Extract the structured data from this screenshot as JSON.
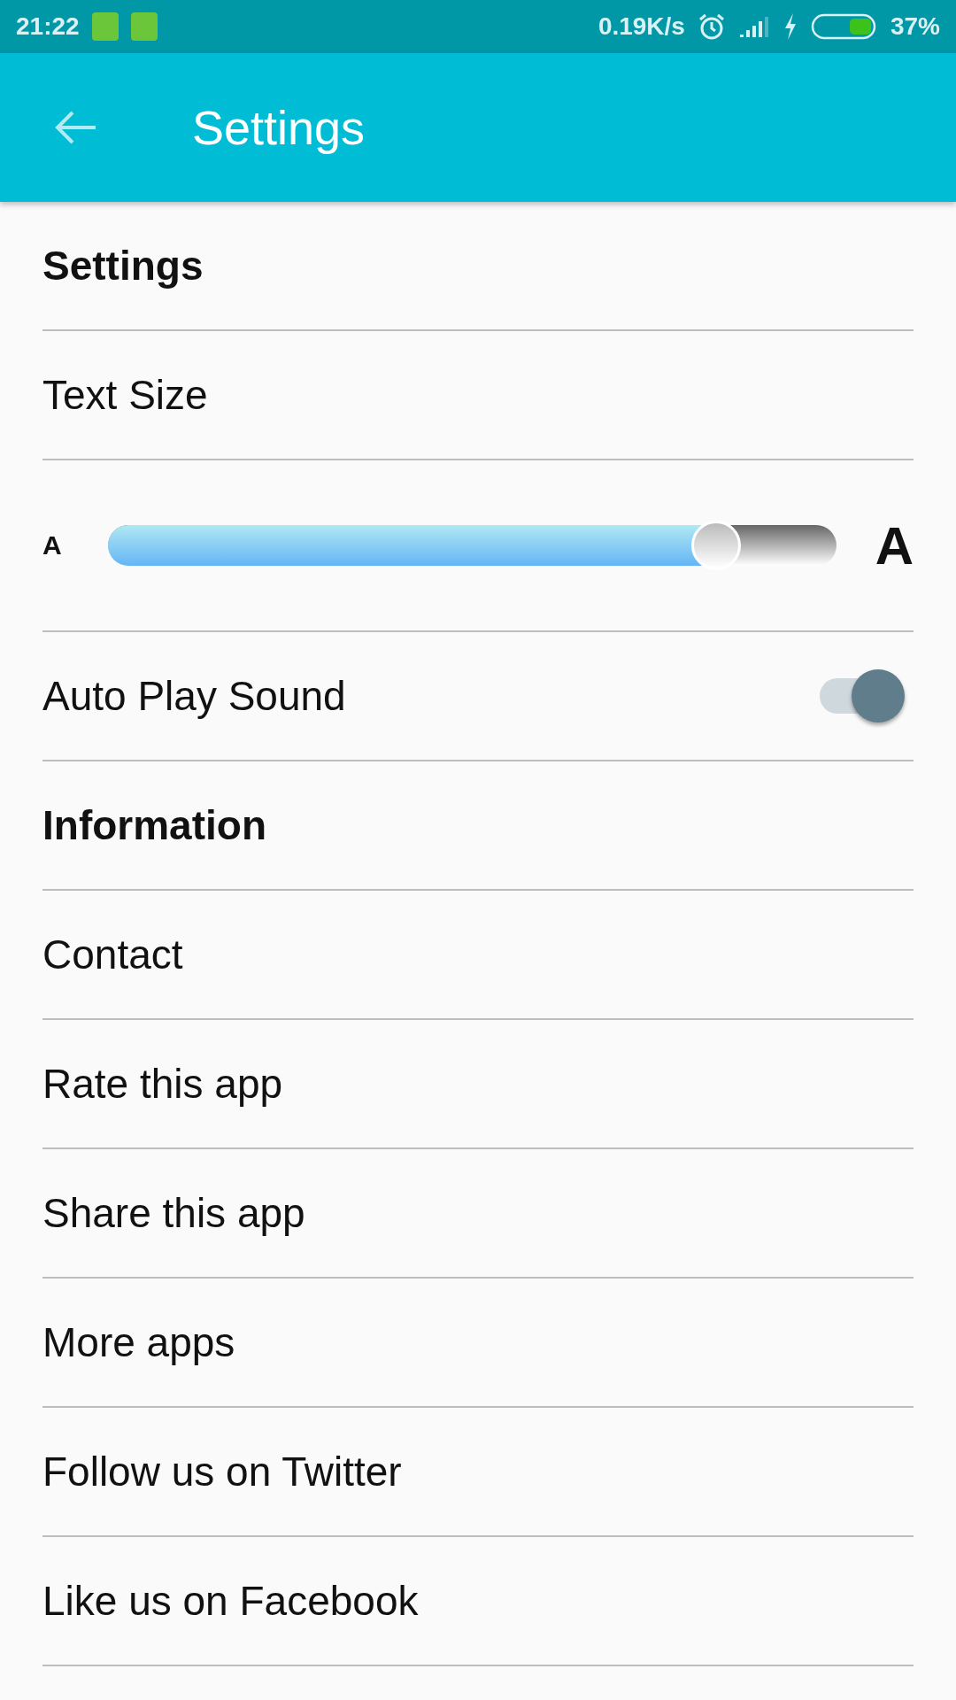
{
  "status_bar": {
    "time": "21:22",
    "speed": "0.19K/s",
    "battery": "37%"
  },
  "app_bar": {
    "title": "Settings"
  },
  "rows": [
    {
      "kind": "header",
      "label": "Settings"
    },
    {
      "kind": "item",
      "label": "Text Size"
    },
    {
      "kind": "slider",
      "small_label": "A",
      "large_label": "A",
      "level": 0.835
    },
    {
      "kind": "toggle",
      "label": "Auto Play Sound",
      "on": true
    },
    {
      "kind": "header",
      "label": "Information"
    },
    {
      "kind": "item",
      "label": "Contact"
    },
    {
      "kind": "item",
      "label": "Rate this app"
    },
    {
      "kind": "item",
      "label": "Share this app"
    },
    {
      "kind": "item",
      "label": "More apps"
    },
    {
      "kind": "item",
      "label": "Follow us on Twitter"
    },
    {
      "kind": "item",
      "label": "Like us on Facebook"
    }
  ]
}
